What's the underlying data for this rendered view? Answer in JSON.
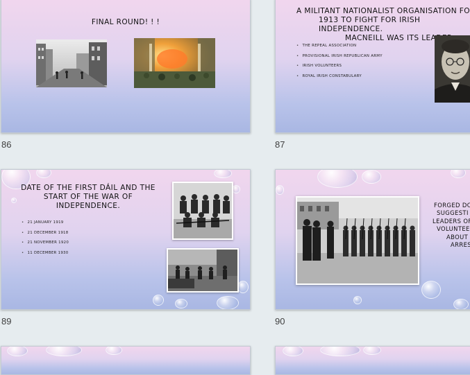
{
  "slides": [
    {
      "number": "86",
      "title": "FINAL ROUND! ! !"
    },
    {
      "number": "87",
      "title": "A MILITANT NATIONALIST ORGANISATION FO 1913 TO FIGHT FOR IRISH INDEPENDENCE. MACNEILL WAS ITS LEADER.",
      "title_lines": [
        "A MILITANT NATIONALIST ORGANISATION FO",
        "1913 TO FIGHT FOR IRISH INDEPENDENCE.",
        "MACNEILL WAS ITS LEADER."
      ],
      "options": [
        "The Repeal Association",
        "Provisional Irish Republican Army",
        "Irish Volunteers",
        "Royal Irish Constabulary"
      ]
    },
    {
      "number": "89",
      "title_lines": [
        "DATE OF THE FIRST DÁIL AND THE",
        "START OF THE WAR OF",
        "INDEPENDENCE."
      ],
      "options": [
        "21 January 1919",
        "21 December 1918",
        "21 November 1920",
        "11 December 1930"
      ]
    },
    {
      "number": "90",
      "title_lines": [
        "FORGED DO",
        "SUGGESTI",
        "LEADERS OF",
        "VOLUNTEE",
        "ABOUT",
        "ARRES"
      ]
    }
  ],
  "colors": {
    "background": "#e6ecef",
    "slide_top": "#f1d6ee",
    "slide_bottom": "#a9b7e3"
  }
}
